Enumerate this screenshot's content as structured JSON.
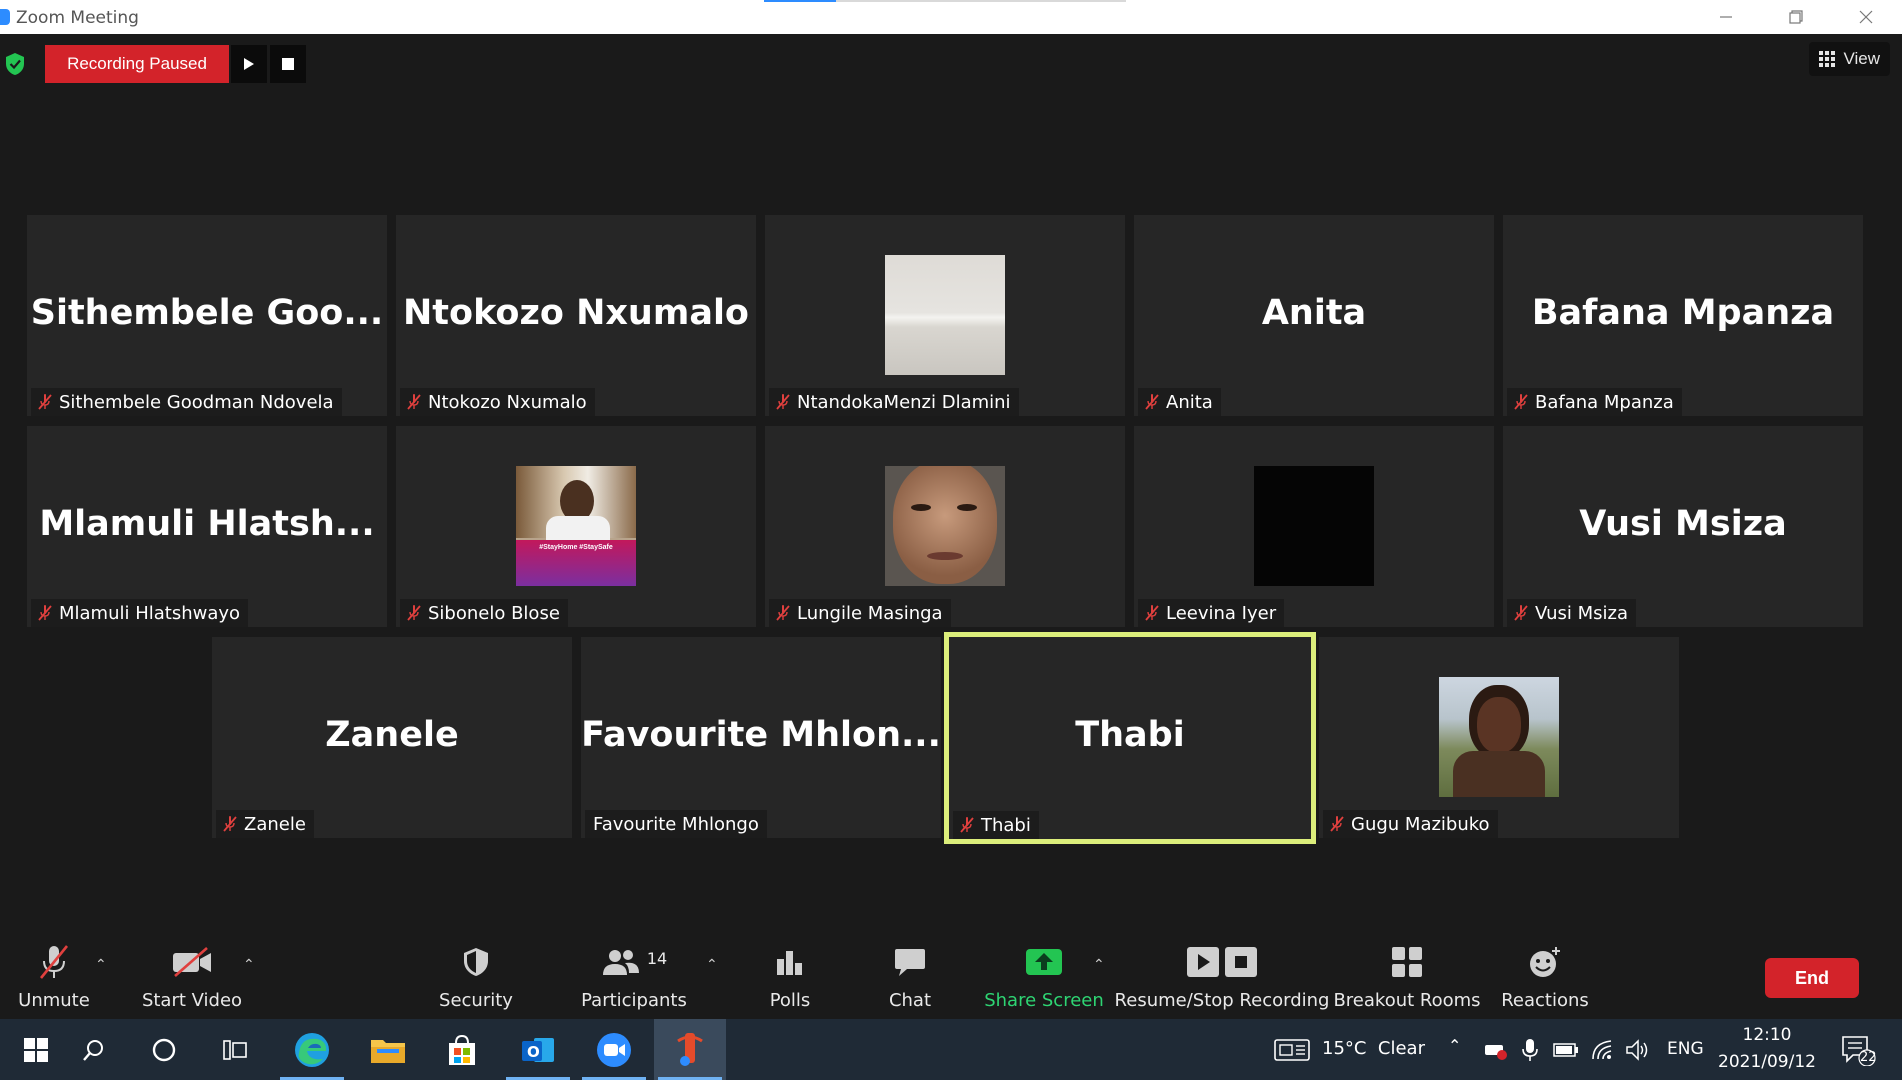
{
  "window": {
    "title": "Zoom Meeting",
    "load_progress": 0.2
  },
  "recording": {
    "status": "Recording Paused"
  },
  "view_button": {
    "label": "View"
  },
  "tiles": [
    {
      "big_name": "Sithembele  Goo...",
      "label": "Sithembele Goodman Ndovela",
      "muted": true,
      "photo": null
    },
    {
      "big_name": "Ntokozo Nxumalo",
      "label": "Ntokozo Nxumalo",
      "muted": true,
      "photo": null
    },
    {
      "big_name": "",
      "label": "NtandokaMenzi Dlamini",
      "muted": true,
      "photo": "wall"
    },
    {
      "big_name": "Anita",
      "label": "Anita",
      "muted": true,
      "photo": null
    },
    {
      "big_name": "Bafana Mpanza",
      "label": "Bafana Mpanza",
      "muted": true,
      "photo": null
    },
    {
      "big_name": "Mlamuli  Hlatsh...",
      "label": "Mlamuli Hlatshwayo",
      "muted": true,
      "photo": null
    },
    {
      "big_name": "",
      "label": "Sibonelo Blose",
      "muted": true,
      "photo": "stayhome"
    },
    {
      "big_name": "",
      "label": "Lungile Masinga",
      "muted": true,
      "photo": "face"
    },
    {
      "big_name": "",
      "label": "Leevina Iyer",
      "muted": true,
      "photo": "black"
    },
    {
      "big_name": "Vusi Msiza",
      "label": "Vusi Msiza",
      "muted": true,
      "photo": null
    },
    {
      "big_name": "Zanele",
      "label": "Zanele",
      "muted": true,
      "photo": null
    },
    {
      "big_name": "Favourite  Mhlon...",
      "label": "Favourite Mhlongo",
      "muted": false,
      "photo": null
    },
    {
      "big_name": "Thabi",
      "label": "Thabi",
      "muted": true,
      "photo": null,
      "active_speaker": true
    },
    {
      "big_name": "",
      "label": "Gugu Mazibuko",
      "muted": true,
      "photo": "outdoor"
    }
  ],
  "toolbar": {
    "unmute": "Unmute",
    "start_video": "Start Video",
    "security": "Security",
    "participants": "Participants",
    "participants_count": "14",
    "polls": "Polls",
    "chat": "Chat",
    "share_screen": "Share Screen",
    "recording": "Resume/Stop Recording",
    "breakout": "Breakout Rooms",
    "reactions": "Reactions",
    "end": "End"
  },
  "photo_text": {
    "stayhome_banner": "#StayHome #StaySafe"
  },
  "taskbar": {
    "weather": "15°C  Clear",
    "language": "ENG",
    "time": "12:10",
    "date": "2021/09/12",
    "notifications": "22"
  },
  "colors": {
    "accent": "#2d8cff",
    "end_red": "#d3232a",
    "active_border": "#dcee7b",
    "share_green": "#2ed573"
  }
}
